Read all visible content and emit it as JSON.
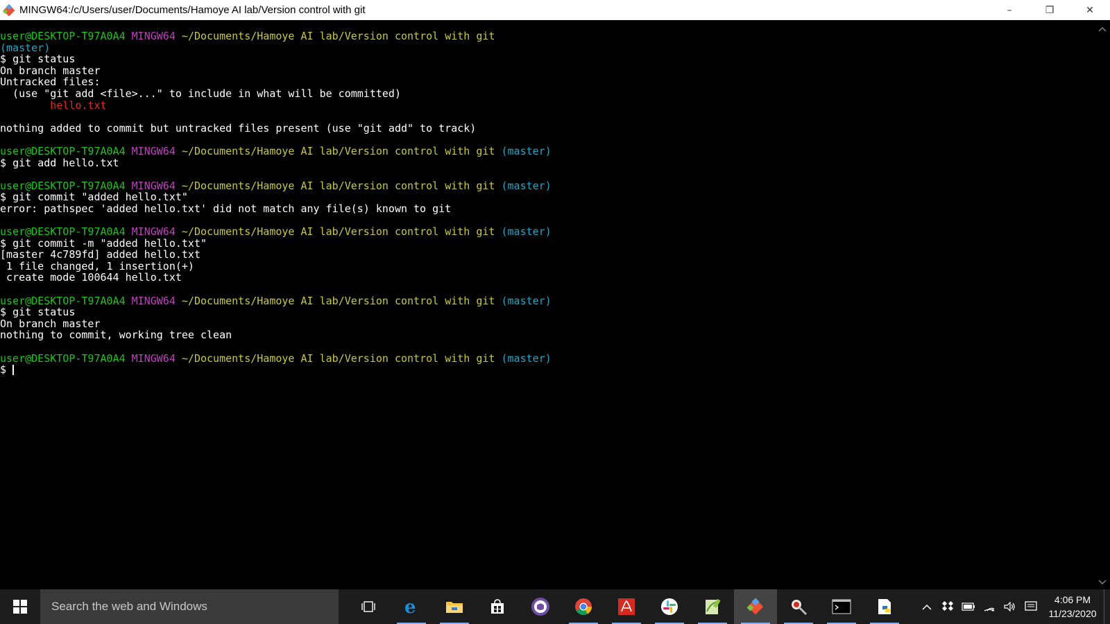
{
  "window": {
    "title": "MINGW64:/c/Users/user/Documents/Hamoye AI lab/Version control with git",
    "minimize": "–",
    "maximize": "❐",
    "close": "✕"
  },
  "prompt": {
    "user": "user@DESKTOP-T97A0A4",
    "env": "MINGW64",
    "path": "~/Documents/Hamoye AI lab/Version control with git",
    "branch": "(master)",
    "symbol": "$"
  },
  "terminal": {
    "blocks": [
      {
        "prompt_wrapped": true,
        "command": "git status",
        "output": [
          {
            "text": "On branch master",
            "color": ""
          },
          {
            "text": "Untracked files:",
            "color": ""
          },
          {
            "text": "  (use \"git add <file>...\" to include in what will be committed)",
            "color": ""
          },
          {
            "text": "        hello.txt",
            "color": "red"
          },
          {
            "text": "",
            "color": ""
          },
          {
            "text": "nothing added to commit but untracked files present (use \"git add\" to track)",
            "color": ""
          },
          {
            "text": "",
            "color": ""
          }
        ]
      },
      {
        "prompt_wrapped": false,
        "command": "git add hello.txt",
        "output": [
          {
            "text": "",
            "color": ""
          }
        ]
      },
      {
        "prompt_wrapped": false,
        "command": "git commit \"added hello.txt\"",
        "output": [
          {
            "text": "error: pathspec 'added hello.txt' did not match any file(s) known to git",
            "color": ""
          },
          {
            "text": "",
            "color": ""
          }
        ]
      },
      {
        "prompt_wrapped": false,
        "command": "git commit -m \"added hello.txt\"",
        "output": [
          {
            "text": "[master 4c789fd] added hello.txt",
            "color": ""
          },
          {
            "text": " 1 file changed, 1 insertion(+)",
            "color": ""
          },
          {
            "text": " create mode 100644 hello.txt",
            "color": ""
          },
          {
            "text": "",
            "color": ""
          }
        ]
      },
      {
        "prompt_wrapped": false,
        "command": "git status",
        "output": [
          {
            "text": "On branch master",
            "color": ""
          },
          {
            "text": "nothing to commit, working tree clean",
            "color": ""
          },
          {
            "text": "",
            "color": ""
          }
        ]
      },
      {
        "prompt_wrapped": false,
        "command": "",
        "output": []
      }
    ]
  },
  "taskbar": {
    "search_placeholder": "Search the web and Windows",
    "apps": [
      {
        "name": "task-view",
        "icon": "task-view-icon",
        "running": false,
        "active": false
      },
      {
        "name": "edge",
        "icon": "edge-icon",
        "running": true,
        "active": false
      },
      {
        "name": "file-explorer",
        "icon": "folder-icon",
        "running": true,
        "active": false
      },
      {
        "name": "store",
        "icon": "store-icon",
        "running": false,
        "active": false
      },
      {
        "name": "github",
        "icon": "github-icon",
        "running": false,
        "active": false
      },
      {
        "name": "chrome",
        "icon": "chrome-icon",
        "running": true,
        "active": false
      },
      {
        "name": "acrobat",
        "icon": "acrobat-icon",
        "running": true,
        "active": false
      },
      {
        "name": "slack",
        "icon": "slack-icon",
        "running": true,
        "active": false
      },
      {
        "name": "notepad-plus",
        "icon": "notepad-plus-icon",
        "running": true,
        "active": false
      },
      {
        "name": "git-bash",
        "icon": "git-icon",
        "running": true,
        "active": true
      },
      {
        "name": "snipping-tool",
        "icon": "snipping-tool-icon",
        "running": true,
        "active": false
      },
      {
        "name": "command-prompt",
        "icon": "cmd-icon",
        "running": true,
        "active": false
      },
      {
        "name": "python-file",
        "icon": "python-file-icon",
        "running": true,
        "active": false
      }
    ],
    "tray": {
      "time": "4:06 PM",
      "date": "11/23/2020"
    }
  },
  "colors": {
    "user": "#17c717",
    "env": "#c33cc3",
    "path": "#c8c83a",
    "branch": "#1aa8c8",
    "untracked": "#e8261e"
  }
}
